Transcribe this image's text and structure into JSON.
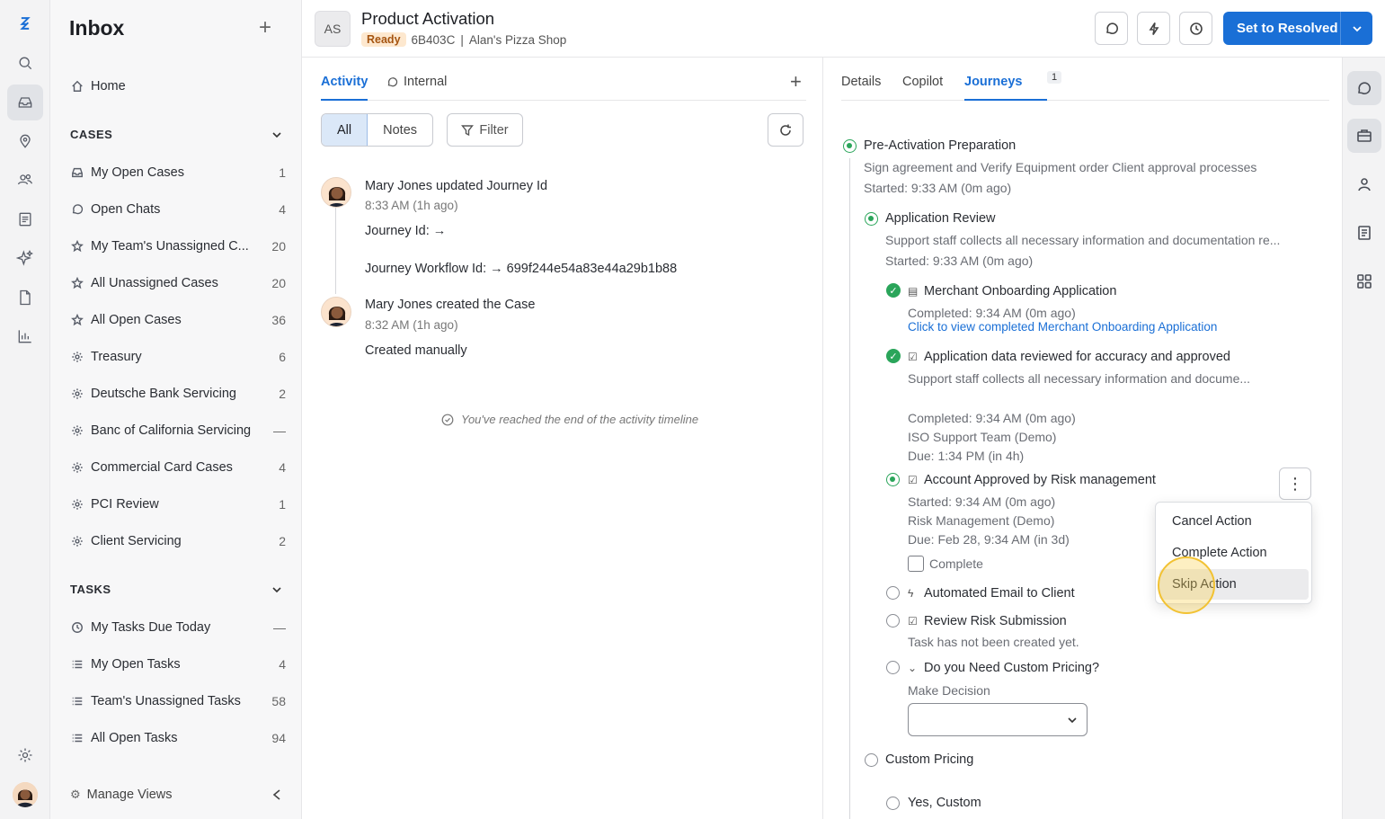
{
  "sidebar": {
    "title": "Inbox",
    "home_label": "Home",
    "cases_heading": "CASES",
    "cases": [
      {
        "label": "My Open Cases",
        "count": "1",
        "icon": "inbox-icon"
      },
      {
        "label": "Open Chats",
        "count": "4",
        "icon": "chat-icon"
      },
      {
        "label": "My Team's Unassigned C...",
        "count": "20",
        "icon": "star-icon"
      },
      {
        "label": "All Unassigned Cases",
        "count": "20",
        "icon": "star-icon"
      },
      {
        "label": "All Open Cases",
        "count": "36",
        "icon": "star-icon"
      },
      {
        "label": "Treasury",
        "count": "6",
        "icon": "gear-icon"
      },
      {
        "label": "Deutsche Bank Servicing",
        "count": "2",
        "icon": "gear-icon"
      },
      {
        "label": "Banc of California Servicing",
        "count": "—",
        "icon": "gear-icon"
      },
      {
        "label": "Commercial Card Cases",
        "count": "4",
        "icon": "gear-icon"
      },
      {
        "label": "PCI Review",
        "count": "1",
        "icon": "gear-icon"
      },
      {
        "label": "Client Servicing",
        "count": "2",
        "icon": "gear-icon"
      }
    ],
    "tasks_heading": "TASKS",
    "tasks": [
      {
        "label": "My Tasks Due Today",
        "count": "—",
        "icon": "clock-icon"
      },
      {
        "label": "My Open Tasks",
        "count": "4",
        "icon": "list-icon"
      },
      {
        "label": "Team's Unassigned Tasks",
        "count": "58",
        "icon": "list-icon"
      },
      {
        "label": "All Open Tasks",
        "count": "94",
        "icon": "list-icon"
      }
    ],
    "manage_views": "Manage Views"
  },
  "header": {
    "avatar_initials": "AS",
    "title": "Product Activation",
    "status": "Ready",
    "case_id": "6B403C",
    "separator": "|",
    "customer": "Alan's Pizza Shop",
    "resolve_label": "Set to Resolved",
    "accent": "#1a6fd6"
  },
  "activity": {
    "tabs": [
      "Activity",
      "Internal"
    ],
    "segments": [
      "All",
      "Notes"
    ],
    "filter_label": "Filter",
    "entries": [
      {
        "title": "Mary Jones updated Journey Id",
        "time": "8:33 AM (1h ago)",
        "lines": [
          "Journey Id: →",
          "Journey Workflow Id: → 699f244e54a83e44a29b1b88"
        ]
      },
      {
        "title": "Mary Jones created the Case",
        "time": "8:32 AM (1h ago)",
        "lines": [
          "Created manually"
        ]
      }
    ],
    "end_note": "You've reached the end of the activity timeline"
  },
  "journeys": {
    "tabs": [
      "Details",
      "Copilot",
      "Journeys"
    ],
    "journeys_count": "1",
    "stage": {
      "title": "Pre-Activation Preparation",
      "description": "Sign agreement and Verify Equipment order Client approval processes",
      "started": "Started: 9:33 AM (0m ago)"
    },
    "step": {
      "title": "Application Review",
      "description": "Support staff collects all necessary information and documentation re...",
      "started": "Started: 9:33 AM (0m ago)"
    },
    "actions": [
      {
        "title": "Merchant Onboarding Application",
        "completed": "Completed: 9:34 AM (0m ago)",
        "link": "Click to view completed Merchant Onboarding Application"
      },
      {
        "title": "Application data reviewed for accuracy and approved",
        "description": "Support staff collects all necessary information and docume...",
        "completed": "Completed: 9:34 AM (0m ago)",
        "team": "ISO Support Team (Demo)",
        "due": "Due: 1:34 PM (in 4h)"
      },
      {
        "title": "Account Approved by Risk management",
        "started": "Started: 9:34 AM (0m ago)",
        "team": "Risk Management (Demo)",
        "due": "Due: Feb 28, 9:34 AM (in 3d)",
        "checkbox_label": "Complete"
      },
      {
        "title": "Automated Email to Client"
      },
      {
        "title": "Review Risk Submission",
        "note": "Task has not been created yet."
      },
      {
        "title": "Do you Need Custom Pricing?",
        "decision_label": "Make Decision"
      }
    ],
    "next_stage": "Custom Pricing",
    "next_option": "Yes, Custom",
    "menu": [
      "Cancel Action",
      "Complete Action",
      "Skip Action"
    ]
  }
}
